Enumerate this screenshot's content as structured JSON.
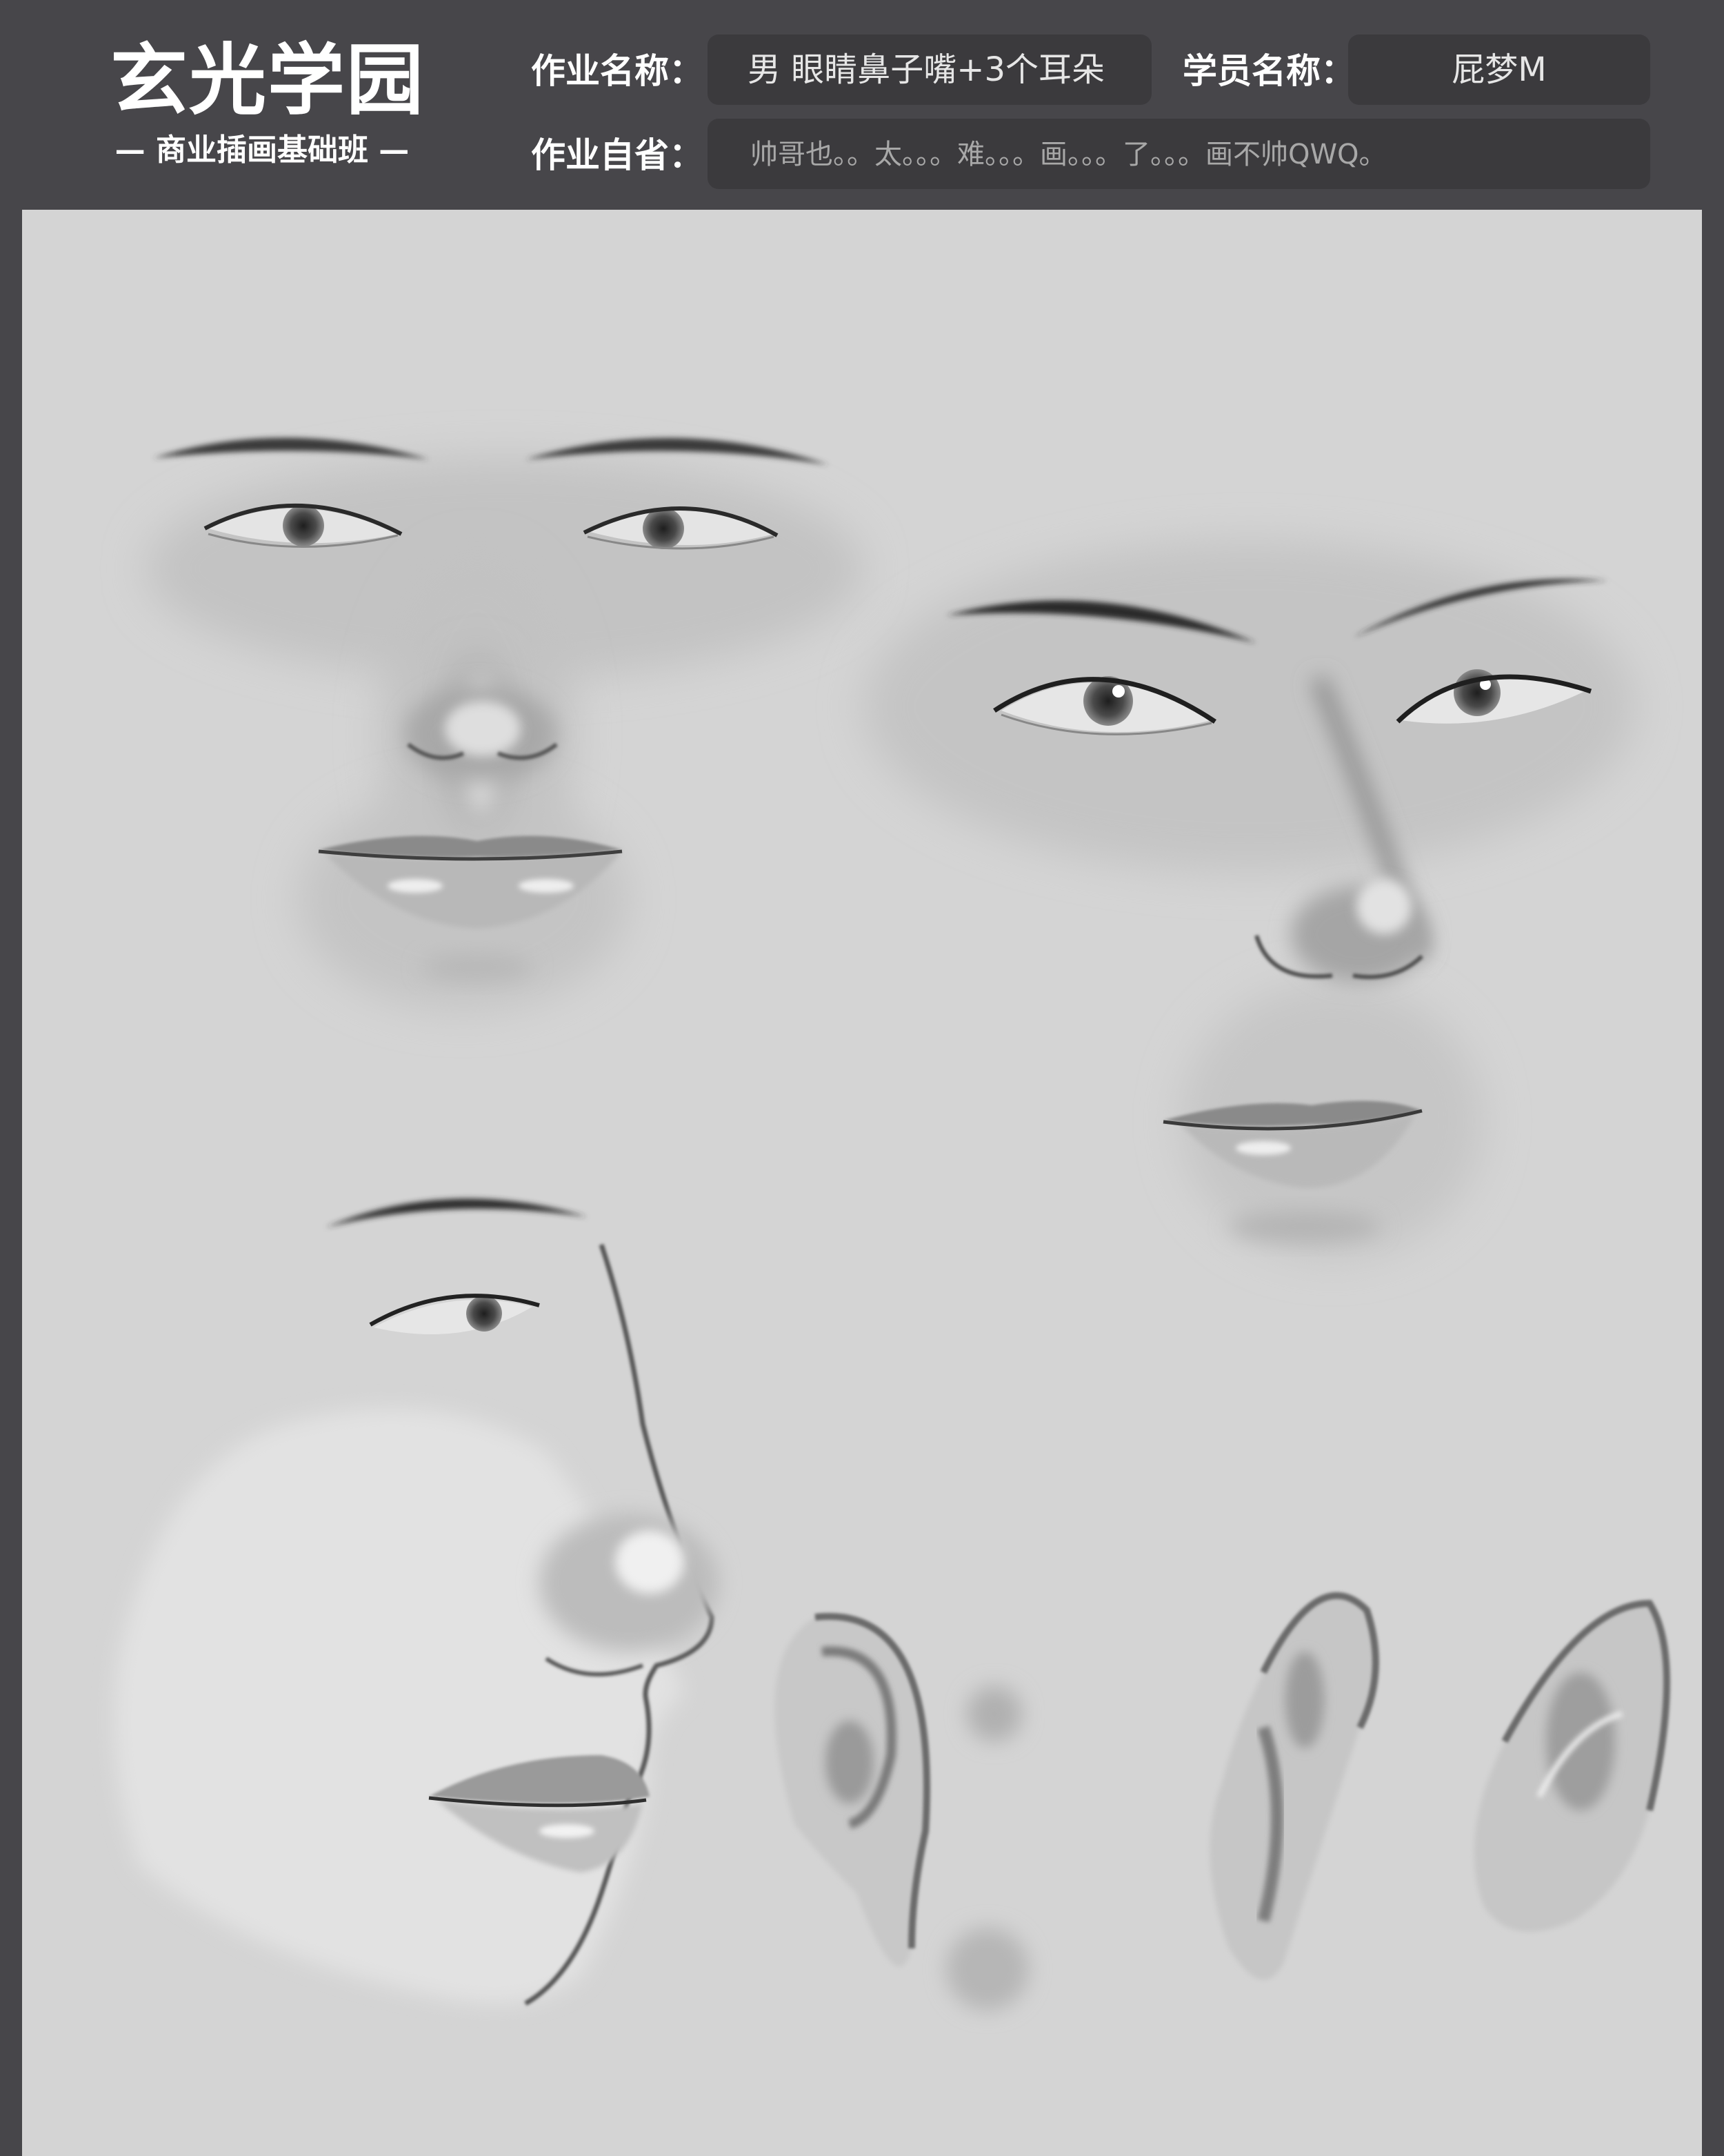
{
  "header": {
    "logo": {
      "title": "玄光学园",
      "subtitle": "— 商业插画基础班 —"
    },
    "assignment_name_label": "作业名称：",
    "assignment_name_value": "男  眼睛鼻子嘴+3个耳朵",
    "student_name_label": "学员名称：",
    "student_name_value": "屁梦M",
    "self_review_label": "作业自省：",
    "self_review_value": "帅哥也。。太。。。难。。。画。。。了。。。画不帅QWQ。"
  },
  "colors": {
    "frame": "#47464a",
    "field_background": "#3b3a3d",
    "canvas": "#d4d4d4",
    "field_text": "#e6e6e6",
    "field_text_dim": "#a8a8a8"
  }
}
